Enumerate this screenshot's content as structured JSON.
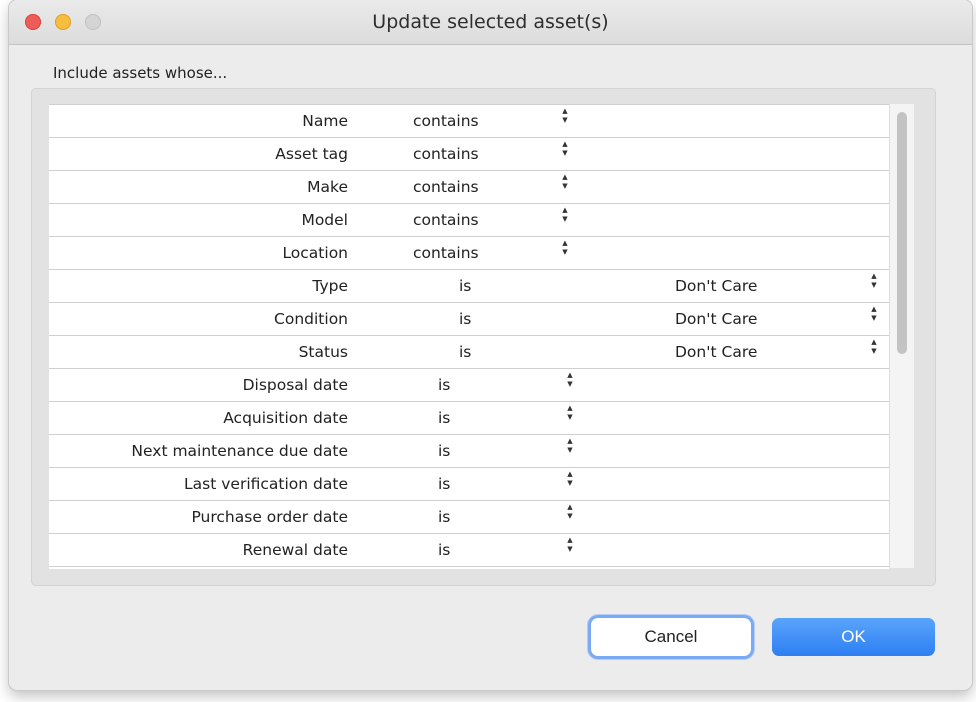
{
  "window": {
    "title": "Update selected asset(s)"
  },
  "dialog": {
    "include_label": "Include assets whose...",
    "rows": [
      {
        "field": "Name",
        "operator": "contains",
        "value": ""
      },
      {
        "field": "Asset tag",
        "operator": "contains",
        "value": ""
      },
      {
        "field": "Make",
        "operator": "contains",
        "value": ""
      },
      {
        "field": "Model",
        "operator": "contains",
        "value": ""
      },
      {
        "field": "Location",
        "operator": "contains",
        "value": ""
      },
      {
        "field": "Type",
        "operator": "is",
        "value": "Don't Care"
      },
      {
        "field": "Condition",
        "operator": "is",
        "value": "Don't Care"
      },
      {
        "field": "Status",
        "operator": "is",
        "value": "Don't Care"
      },
      {
        "field": "Disposal date",
        "operator": "is",
        "value": ""
      },
      {
        "field": "Acquisition date",
        "operator": "is",
        "value": ""
      },
      {
        "field": "Next maintenance due date",
        "operator": "is",
        "value": ""
      },
      {
        "field": "Last verification date",
        "operator": "is",
        "value": ""
      },
      {
        "field": "Purchase order date",
        "operator": "is",
        "value": ""
      },
      {
        "field": "Renewal date",
        "operator": "is",
        "value": ""
      }
    ]
  },
  "buttons": {
    "cancel": "Cancel",
    "ok": "OK"
  },
  "icons": {
    "stepper": "up-down-stepper-icon"
  }
}
